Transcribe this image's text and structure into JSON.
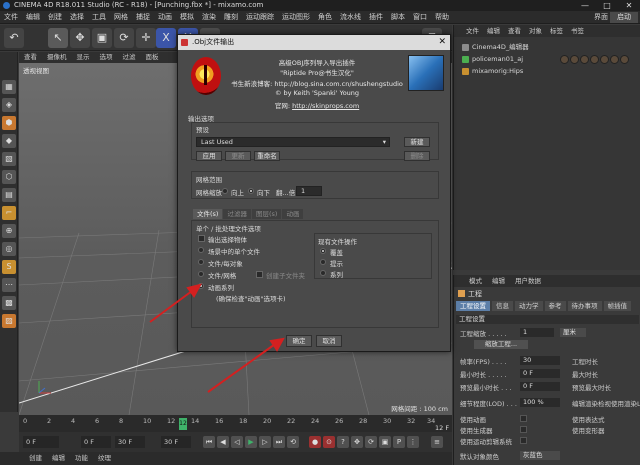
{
  "app": {
    "title": "CINEMA 4D R18.011 Studio (RC - R18) - [Punching.fbx *] - mixamo.com",
    "controls": [
      "—",
      "□",
      "✕"
    ]
  },
  "menubar": {
    "items": [
      "文件",
      "编辑",
      "创建",
      "选择",
      "工具",
      "网格",
      "捕捉",
      "动画",
      "模拟",
      "渲染",
      "雕刻",
      "运动跟踪",
      "运动图形",
      "角色",
      "流水线",
      "插件",
      "脚本",
      "窗口",
      "帮助"
    ],
    "layout_label": "界面",
    "layout_value": "启动"
  },
  "toolbar": {
    "icons": [
      "↶",
      "↖",
      "✥",
      "▣",
      "⟳",
      "✛",
      "X",
      "Y",
      "Z",
      "⊡"
    ]
  },
  "leftbar": {
    "icons": [
      "▦",
      "◈",
      "⬢",
      "◆",
      "▧",
      "⬡",
      "▤",
      "⌐",
      "⊕",
      "◎",
      "S",
      "⋯",
      "▩",
      "▨"
    ]
  },
  "viewport": {
    "menu": [
      "查看",
      "摄像机",
      "显示",
      "选项",
      "过滤",
      "面板"
    ],
    "label": "透视视图",
    "grid_distance": "网格间距 : 100 cm"
  },
  "timeline": {
    "ticks": [
      "0",
      "2",
      "4",
      "6",
      "8",
      "10",
      "12",
      "14",
      "16",
      "18",
      "20",
      "22",
      "24",
      "26",
      "28",
      "30",
      "32",
      "34"
    ],
    "cursor": "12",
    "end_marker": "12 F",
    "start_field": "0 F",
    "current_field": "0 F",
    "end_field": "30 F",
    "max_field": "30 F"
  },
  "bottom_menu": [
    "创建",
    "编辑",
    "功能",
    "纹理"
  ],
  "object_manager": {
    "menu": [
      "文件",
      "编辑",
      "查看",
      "对象",
      "标签",
      "书签"
    ],
    "objects": [
      {
        "name": "Cinema4D_编辑器"
      },
      {
        "name": "policeman01_aj"
      },
      {
        "name": "mixamorig:Hips"
      }
    ]
  },
  "attribute_manager": {
    "menu": [
      "模式",
      "编辑",
      "用户数据"
    ],
    "title": "工程",
    "tabs": [
      "工程设置",
      "信息",
      "动力学",
      "参考",
      "待办事项",
      "帧插值"
    ],
    "section": "工程设置",
    "scale_label": "工程缩放 . . . . .",
    "scale_value": "1",
    "scale_unit": "厘米",
    "scale_button": "缩放工程...",
    "fps_label": "帧率(FPS) . . . .",
    "fps_value": "30",
    "time_label": "工程时长",
    "min_time_label": "最小时长 . . . . .",
    "min_time_value": "0 F",
    "max_time_label": "最大时长",
    "preview_min_label": "预览最小时长 . . .",
    "preview_min_value": "0 F",
    "preview_max_label": "预览最大时长",
    "lod_label": "细节程度(LOD) . . .",
    "lod_value": "100 %",
    "lod_render_label": "编辑渲染检视使用渲染LOD",
    "anim_label": "使用动画",
    "expr_label": "使用表达式",
    "gen_label": "使用生成器",
    "deform_label": "使用变形器",
    "motion_label": "使用运动剪辑系统",
    "default_color_label": "默认对象颜色",
    "default_color_value": "灰蓝色"
  },
  "dialog": {
    "title": ".Obj文件输出",
    "close": "✕",
    "info_lines": [
      "高级OBJ序列导入导出插件",
      "\"Riptide Pro@书生汉化\"",
      "书生新浪博客:  http://blog.sina.com.cn/shushengstudio",
      "© by Keith 'Spanki' Young"
    ],
    "website_label": "官网:",
    "website_url": "http://skinprops.com",
    "output_options_label": "输出选项",
    "preset_label": "预设",
    "preset_value": "Last Used",
    "btn_new": "新建",
    "btn_apply": "应用",
    "btn_update": "更新",
    "btn_rename": "重命名",
    "btn_delete": "删除",
    "range_label": "网格范围",
    "range_scale_label": "网格缩放",
    "range_up": "向上",
    "range_down": "向下",
    "range_flip": "翻...倍:",
    "range_value": "1",
    "sub_tabs": [
      "文件(s)",
      "过滤器",
      "图层(s)",
      "动画"
    ],
    "single_section": "单个 / 批处理文件选项",
    "opt_export_selected": "输出选择物体",
    "opt_single_file": "场景中的单个文件",
    "opt_file_per_object": "文件/每对象",
    "opt_file_per_group": "文件/网格",
    "opt_create_subfolder": "创建子文件夹",
    "opt_anim_series": "动画系列",
    "opt_anim_hint": "(确保检查\"动画\"选项卡)",
    "exist_section": "现有文件操作",
    "exist_overwrite": "覆盖",
    "exist_prompt": "提示",
    "exist_series": "系列",
    "ok": "确定",
    "cancel": "取消"
  },
  "colors": {
    "accent_green": "#3fb26a",
    "annotation_red": "#d42020",
    "tab_active": "#5d7fa8"
  }
}
